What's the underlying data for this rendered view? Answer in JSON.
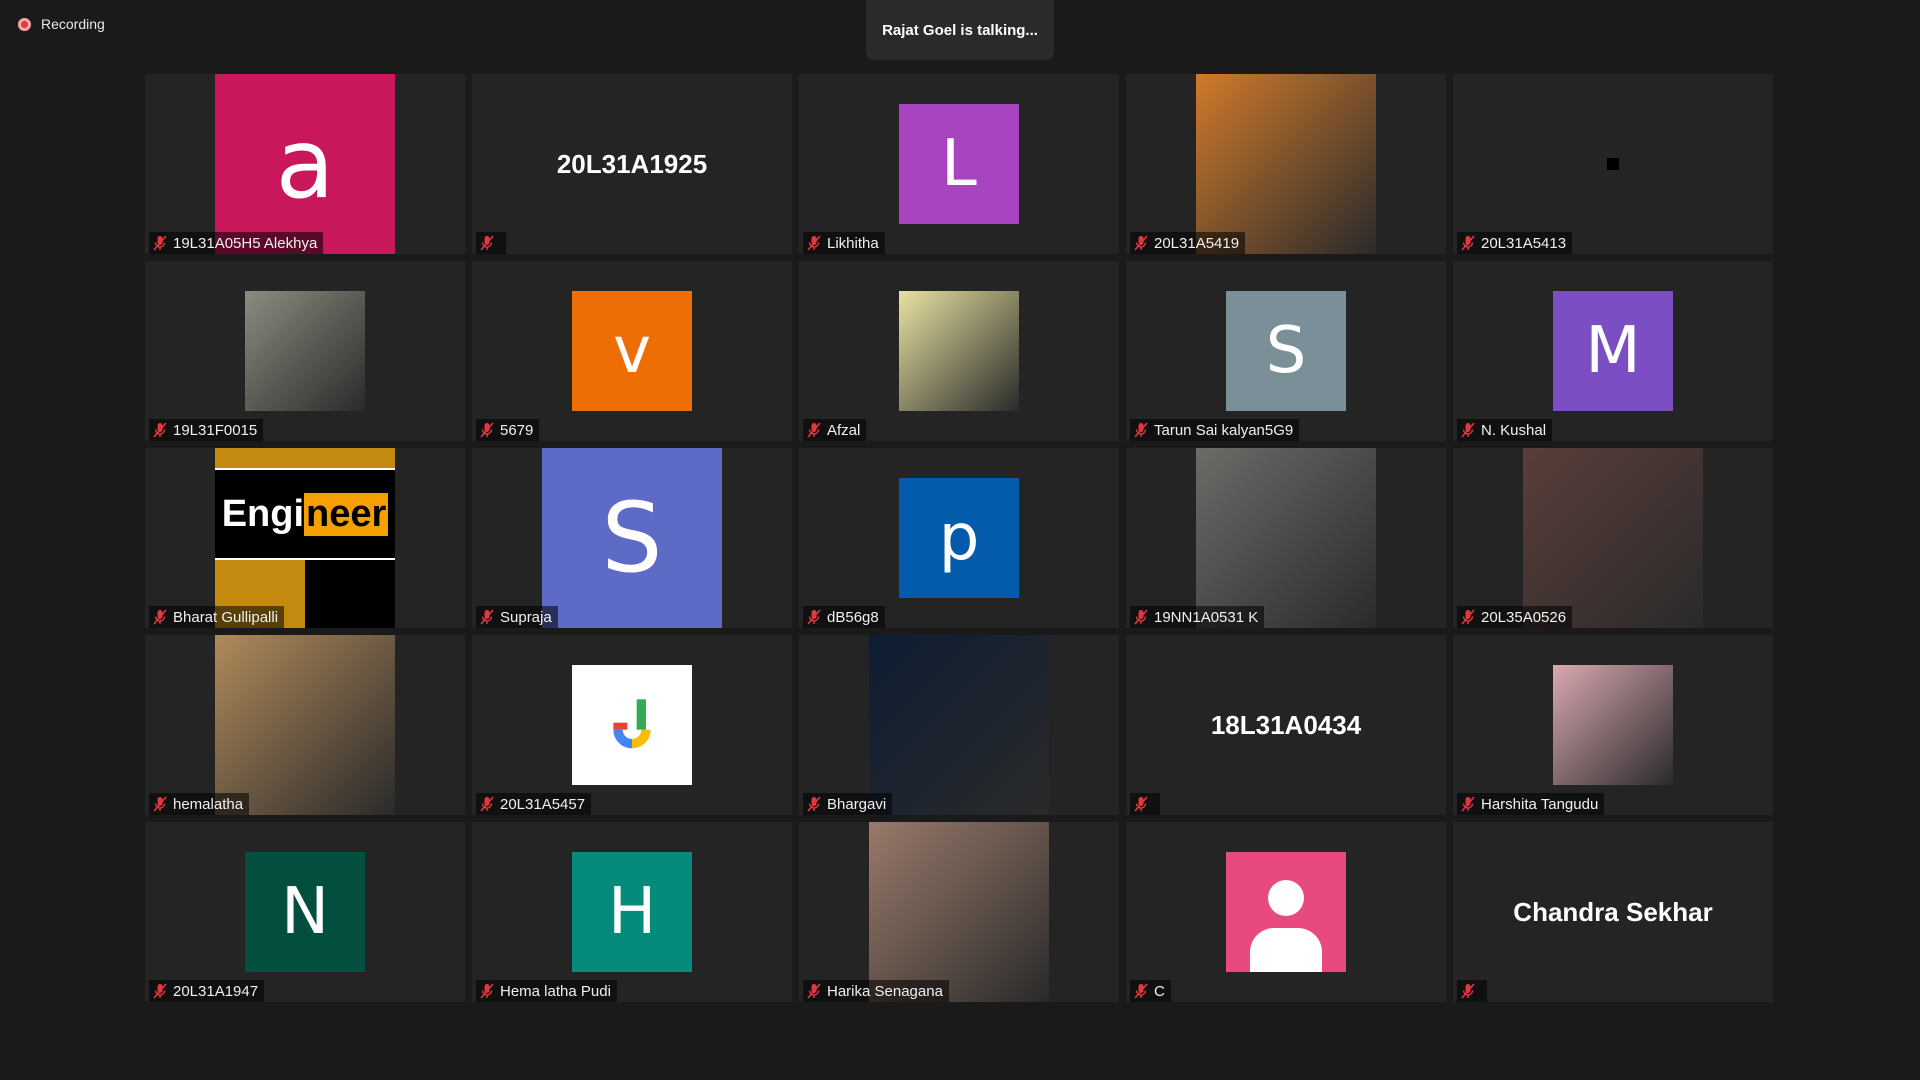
{
  "recording": {
    "label": "Recording"
  },
  "talking": {
    "text": "Rajat Goel is talking..."
  },
  "participants": [
    {
      "name": "19L31A05H5 Alekhya",
      "avatar": "a",
      "bg": "#c8175a",
      "kind": "lg-letter"
    },
    {
      "name": "",
      "display": "20L31A1925",
      "kind": "text"
    },
    {
      "name": "Likhitha",
      "avatar": "L",
      "bg": "#a844c0",
      "kind": "sm-letter"
    },
    {
      "name": "20L31A5419",
      "photo": "anime-character-photo",
      "bg": "#d07a2a",
      "kind": "lg-photo"
    },
    {
      "name": "20L31A5413",
      "kind": "mark"
    },
    {
      "name": "19L31F0015",
      "photo": "outdoor-person-photo",
      "bg": "#8c8c80",
      "kind": "sm-photo"
    },
    {
      "name": "5679",
      "avatar": "v",
      "bg": "#ee6d05",
      "kind": "sm-letter"
    },
    {
      "name": "Afzal",
      "photo": "selfie-photo",
      "bg": "#e8e2a0",
      "kind": "sm-photo"
    },
    {
      "name": "Tarun Sai kalyan5G9",
      "avatar": "S",
      "bg": "#7a8f98",
      "kind": "sm-letter"
    },
    {
      "name": "N. Kushal",
      "avatar": "M",
      "bg": "#7b4fc3",
      "kind": "sm-letter"
    },
    {
      "name": "Bharat Gullipalli",
      "photo": "engineer-logo",
      "logo_text_a": "Engi",
      "logo_text_b": "neer",
      "kind": "lg-logo"
    },
    {
      "name": "Supraja",
      "avatar": "S",
      "bg": "#5e6bc6",
      "kind": "lg-letter"
    },
    {
      "name": "dB56g8",
      "avatar": "p",
      "bg": "#055bab",
      "kind": "sm-letter"
    },
    {
      "name": "19NN1A0531 K",
      "photo": "writing-hand-photo",
      "bg": "#6b6b68",
      "kind": "lg-photo"
    },
    {
      "name": "20L35A0526",
      "photo": "portrait-photo",
      "bg": "#5a3e3a",
      "kind": "lg-photo"
    },
    {
      "name": "hemalatha",
      "photo": "heart-locket-photo",
      "bg": "#b08a5a",
      "kind": "lg-photo"
    },
    {
      "name": "20L31A5457",
      "photo": "j-logo",
      "kind": "sm-jlogo"
    },
    {
      "name": "Bhargavi",
      "photo": "moon-tree-photo",
      "bg": "#0e1d33",
      "kind": "lg-photo"
    },
    {
      "name": "",
      "display": "18L31A0434",
      "kind": "text"
    },
    {
      "name": "Harshita Tangudu",
      "photo": "girl-portrait-photo",
      "bg": "#d8a8b0",
      "kind": "sm-photo"
    },
    {
      "name": "20L31A1947",
      "avatar": "N",
      "bg": "#024e3f",
      "kind": "sm-letter"
    },
    {
      "name": "Hema latha Pudi",
      "avatar": "H",
      "bg": "#068b7b",
      "kind": "sm-letter"
    },
    {
      "name": "Harika Senagana",
      "photo": "young-man-photo",
      "bg": "#9a7a6a",
      "kind": "lg-photo"
    },
    {
      "name": "C",
      "photo": "person-silhouette-icon",
      "bg": "#e84a7f",
      "kind": "sm-icon"
    },
    {
      "name": "",
      "display": "Chandra Sekhar",
      "kind": "text"
    }
  ]
}
